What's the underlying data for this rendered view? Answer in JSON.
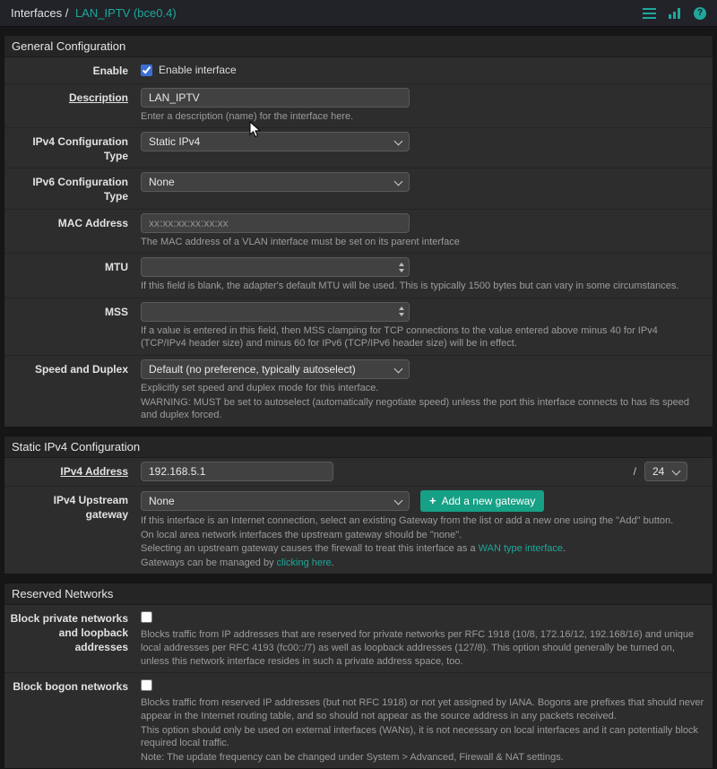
{
  "colors": {
    "accent": "#1fa79b",
    "btn": "#16a085",
    "chk": "#3b6fd4"
  },
  "header": {
    "breadcrumb_root": "Interfaces /",
    "breadcrumb_current": "LAN_IPTV (bce0.4)",
    "icons": [
      "menu-icon",
      "chart-icon",
      "help-icon"
    ]
  },
  "general": {
    "title": "General Configuration",
    "enable": {
      "label": "Enable",
      "checkbox_label": "Enable interface",
      "checked": "checked"
    },
    "description": {
      "label": "Description",
      "value": "LAN_IPTV",
      "help": "Enter a description (name) for the interface here."
    },
    "ipv4_type": {
      "label": "IPv4 Configuration Type",
      "value": "Static IPv4"
    },
    "ipv6_type": {
      "label": "IPv6 Configuration Type",
      "value": "None"
    },
    "mac": {
      "label": "MAC Address",
      "placeholder": "xx:xx:xx:xx:xx:xx",
      "help": "The MAC address of a VLAN interface must be set on its parent interface"
    },
    "mtu": {
      "label": "MTU",
      "help": "If this field is blank, the adapter's default MTU will be used. This is typically 1500 bytes but can vary in some circumstances."
    },
    "mss": {
      "label": "MSS",
      "help": "If a value is entered in this field, then MSS clamping for TCP connections to the value entered above minus 40 for IPv4 (TCP/IPv4 header size) and minus 60 for IPv6 (TCP/IPv6 header size) will be in effect."
    },
    "speed_duplex": {
      "label": "Speed and Duplex",
      "value": "Default (no preference, typically autoselect)",
      "help1": "Explicitly set speed and duplex mode for this interface.",
      "help2": "WARNING: MUST be set to autoselect (automatically negotiate speed) unless the port this interface connects to has its speed and duplex forced."
    }
  },
  "static_ipv4": {
    "title": "Static IPv4 Configuration",
    "address": {
      "label": "IPv4 Address",
      "value": "192.168.5.1",
      "separator": "/",
      "mask": "24"
    },
    "gateway": {
      "label": "IPv4 Upstream gateway",
      "value": "None",
      "add_button": "Add a new gateway",
      "plus": "+",
      "help1": "If this interface is an Internet connection, select an existing Gateway from the list or add a new one using the \"Add\" button.",
      "help2": "On local area network interfaces the upstream gateway should be \"none\".",
      "help3_pre": "Selecting an upstream gateway causes the firewall to treat this interface as a ",
      "help3_link": "WAN type interface",
      "help3_post": ".",
      "help4_pre": "Gateways can be managed by ",
      "help4_link": "clicking here",
      "help4_post": "."
    }
  },
  "reserved": {
    "title": "Reserved Networks",
    "private": {
      "label": "Block private networks and loopback addresses",
      "help": "Blocks traffic from IP addresses that are reserved for private networks per RFC 1918 (10/8, 172.16/12, 192.168/16) and unique local addresses per RFC 4193 (fc00::/7) as well as loopback addresses (127/8). This option should generally be turned on, unless this network interface resides in such a private address space, too."
    },
    "bogon": {
      "label": "Block bogon networks",
      "help1": "Blocks traffic from reserved IP addresses (but not RFC 1918) or not yet assigned by IANA. Bogons are prefixes that should never appear in the Internet routing table, and so should not appear as the source address in any packets received.",
      "help2": "This option should only be used on external interfaces (WANs), it is not necessary on local interfaces and it can potentially block required local traffic.",
      "help3": "Note: The update frequency can be changed under System > Advanced, Firewall & NAT settings."
    }
  }
}
